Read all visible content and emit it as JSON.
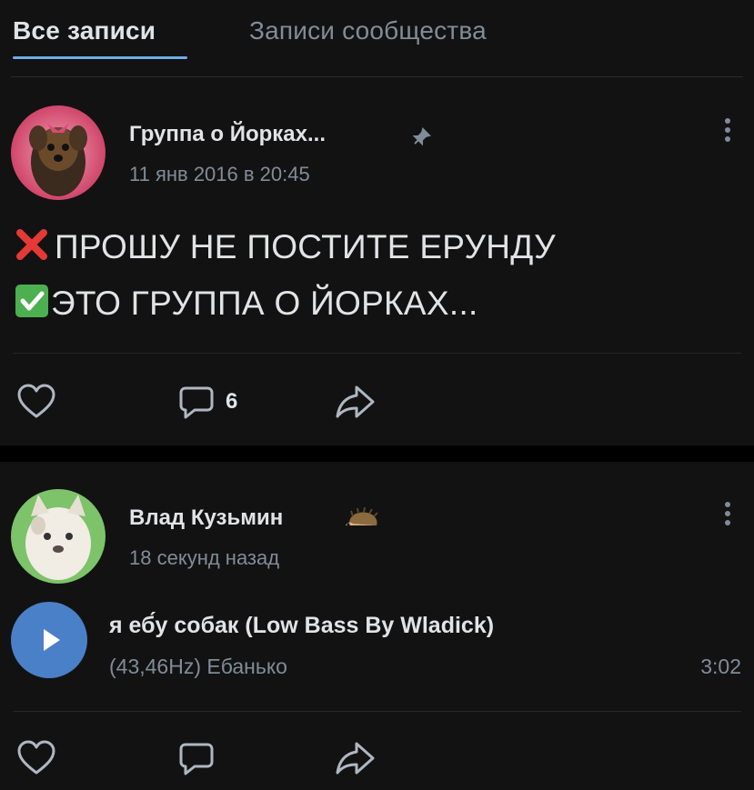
{
  "tabs": {
    "all_posts": "Все записи",
    "community_posts": "Записи сообщества"
  },
  "posts": [
    {
      "author": "Группа о Йорках...",
      "pinned_icon": "pin-icon",
      "time": "11 янв 2016 в 20:45",
      "text_line1": "ПРОШУ НЕ ПОСТИТЕ ЕРУНДУ",
      "text_line1_icon": "red-cross-icon",
      "text_line2": "ЭТО ГРУППА О ЙОРКАХ...",
      "text_line2_icon": "green-check-icon",
      "comments_count": "6"
    },
    {
      "author": "Влад Кузьмин",
      "author_badge_icon": "hedgehog-icon",
      "time": "18 секунд назад",
      "track": {
        "title": "я еб́у собак (Low Bass By Wladick)",
        "artist": "(43,46Hz) Ебанько",
        "duration": "3:02"
      }
    }
  ],
  "colors": {
    "background": "#121212",
    "accent": "#71aaeb",
    "secondary_text": "#818c99",
    "play_button": "#4a80c8",
    "cross": "#e53935",
    "check": "#4caf50"
  }
}
